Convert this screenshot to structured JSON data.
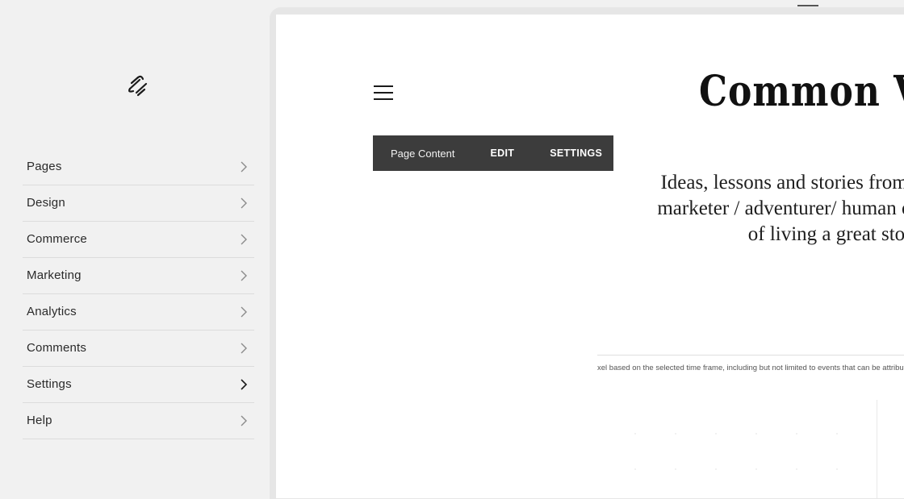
{
  "sidebar": {
    "logo_icon": "squarespace-logo-icon",
    "items": [
      {
        "label": "Pages",
        "icon": "chevron-right-icon"
      },
      {
        "label": "Design",
        "icon": "chevron-right-icon"
      },
      {
        "label": "Commerce",
        "icon": "chevron-right-icon"
      },
      {
        "label": "Marketing",
        "icon": "chevron-right-icon"
      },
      {
        "label": "Analytics",
        "icon": "chevron-right-icon"
      },
      {
        "label": "Comments",
        "icon": "chevron-right-icon"
      },
      {
        "label": "Settings",
        "icon": "chevron-right-icon"
      },
      {
        "label": "Help",
        "icon": "chevron-right-icon"
      }
    ]
  },
  "preview": {
    "site_title": "Common Vanda",
    "menu_icon": "hamburger-menu-icon",
    "toolbar": {
      "label": "Page Content",
      "edit_label": "EDIT",
      "settings_label": "SETTINGS"
    },
    "tagline": "Ideas, lessons and stories from a\nmarketer / adventurer/ human on\nof living a great story",
    "info_text": "xel based on the selected time frame, including but not limited to events that can be attribute"
  },
  "colors": {
    "sidebar_bg": "#f1f1f1",
    "toolbar_bg": "#3c3c3c",
    "text": "#2a2a2a"
  }
}
